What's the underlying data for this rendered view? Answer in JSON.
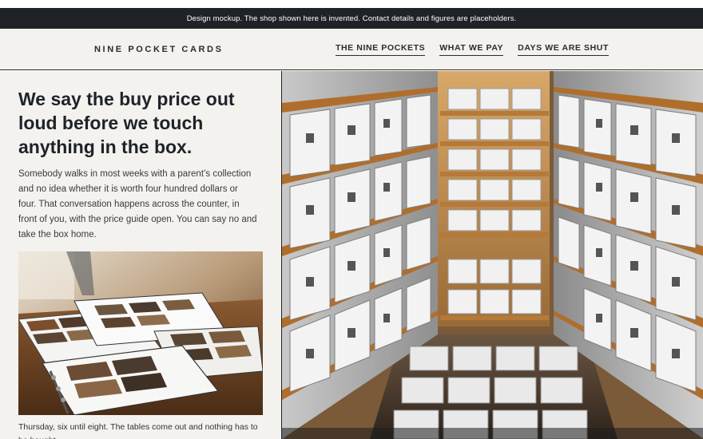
{
  "notice": "Design mockup. The shop shown here is invented. Contact details and figures are placeholders.",
  "brand": "NINE POCKET CARDS",
  "nav": [
    "THE NINE POCKETS",
    "WHAT WE PAY",
    "DAYS WE ARE SHUT"
  ],
  "hero": {
    "headline": "We say the buy price out loud before we touch anything in the box.",
    "body": "Somebody walks in most weeks with a parent’s collection and no idea whether it is worth four hundred dollars or four. That conversation happens across the counter, in front of you, with the price guide open. You can say no and take the box home."
  },
  "photo_caption": "Thursday, six until eight. The tables come out and nothing has to be bought."
}
